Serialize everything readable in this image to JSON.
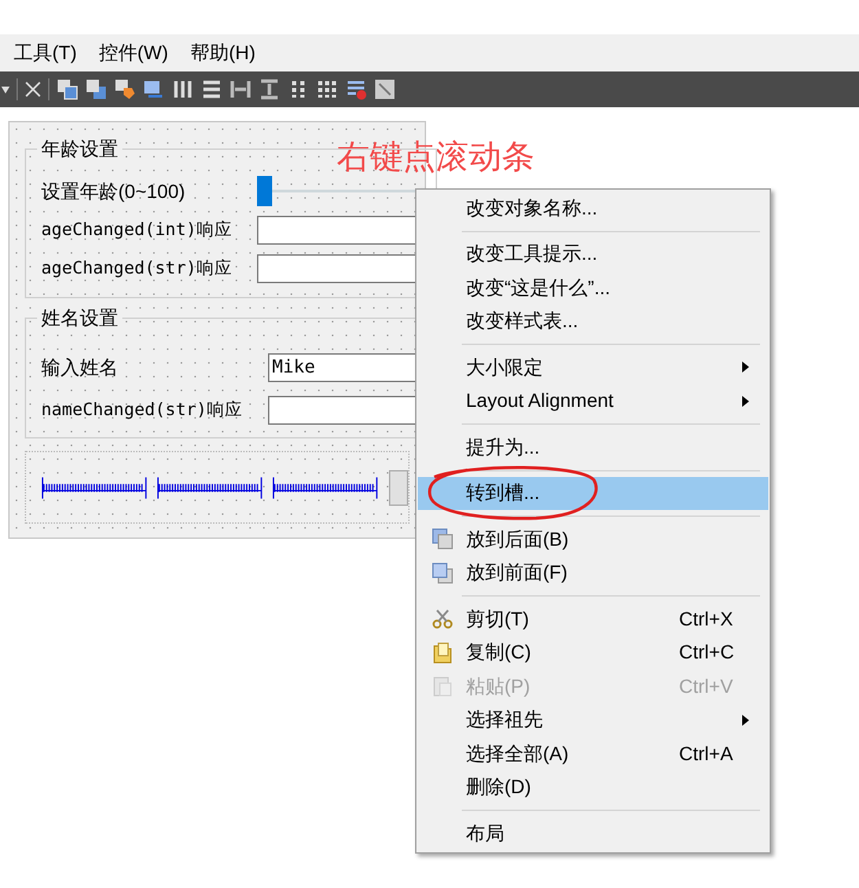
{
  "menubar": [
    {
      "label": "工具(T)"
    },
    {
      "label": "控件(W)"
    },
    {
      "label": "帮助(H)"
    }
  ],
  "form": {
    "annotation": "右键点滚动条",
    "groups": [
      {
        "title": "年龄设置",
        "rows": [
          {
            "kind": "slider",
            "label": "设置年龄(0~100)",
            "level": 0
          },
          {
            "kind": "field",
            "label": "ageChanged(int)响应"
          },
          {
            "kind": "field",
            "label": "ageChanged(str)响应"
          }
        ]
      },
      {
        "title": "姓名设置",
        "rows": [
          {
            "kind": "field",
            "label": "输入姓名",
            "value": "Mike"
          },
          {
            "kind": "field",
            "label": "nameChanged(str)响应"
          }
        ]
      }
    ]
  },
  "context_menu": {
    "items": [
      {
        "kind": "item",
        "label": "改变对象名称...",
        "selected": false,
        "disabled": false,
        "submenu": false
      },
      {
        "kind": "separator"
      },
      {
        "kind": "item",
        "label": "改变工具提示...",
        "selected": false,
        "disabled": false,
        "submenu": false
      },
      {
        "kind": "item",
        "label": "改变“这是什么”...",
        "selected": false,
        "disabled": false,
        "submenu": false
      },
      {
        "kind": "item",
        "label": "改变样式表...",
        "selected": false,
        "disabled": false,
        "submenu": false
      },
      {
        "kind": "separator"
      },
      {
        "kind": "item",
        "label": "大小限定",
        "selected": false,
        "disabled": false,
        "submenu": true
      },
      {
        "kind": "item",
        "label": "Layout Alignment",
        "selected": false,
        "disabled": false,
        "submenu": true
      },
      {
        "kind": "separator"
      },
      {
        "kind": "item",
        "label": "提升为...",
        "selected": false,
        "disabled": false,
        "submenu": false
      },
      {
        "kind": "separator"
      },
      {
        "kind": "item",
        "label": "转到槽...",
        "selected": true,
        "disabled": false,
        "submenu": false
      },
      {
        "kind": "separator"
      },
      {
        "kind": "back",
        "label": "放到后面(B)",
        "selected": false,
        "disabled": false,
        "submenu": false
      },
      {
        "kind": "front",
        "label": "放到前面(F)",
        "selected": false,
        "disabled": false,
        "submenu": false
      },
      {
        "kind": "separator"
      },
      {
        "kind": "cut",
        "label": "剪切(T)",
        "shortcut": "Ctrl+X",
        "selected": false,
        "disabled": false,
        "submenu": false
      },
      {
        "kind": "copy",
        "label": "复制(C)",
        "shortcut": "Ctrl+C",
        "selected": false,
        "disabled": false,
        "submenu": false
      },
      {
        "kind": "paste",
        "label": "粘贴(P)",
        "shortcut": "Ctrl+V",
        "selected": false,
        "disabled": true,
        "submenu": false
      },
      {
        "kind": "item",
        "label": "选择祖先",
        "selected": false,
        "disabled": false,
        "submenu": true
      },
      {
        "kind": "item",
        "label": "选择全部(A)",
        "shortcut": "Ctrl+A",
        "selected": false,
        "disabled": false,
        "submenu": false
      },
      {
        "kind": "item",
        "label": "删除(D)",
        "selected": false,
        "disabled": false,
        "submenu": false
      },
      {
        "kind": "separator"
      },
      {
        "kind": "item",
        "label": "布局",
        "selected": false,
        "disabled": false,
        "submenu": false
      }
    ]
  }
}
